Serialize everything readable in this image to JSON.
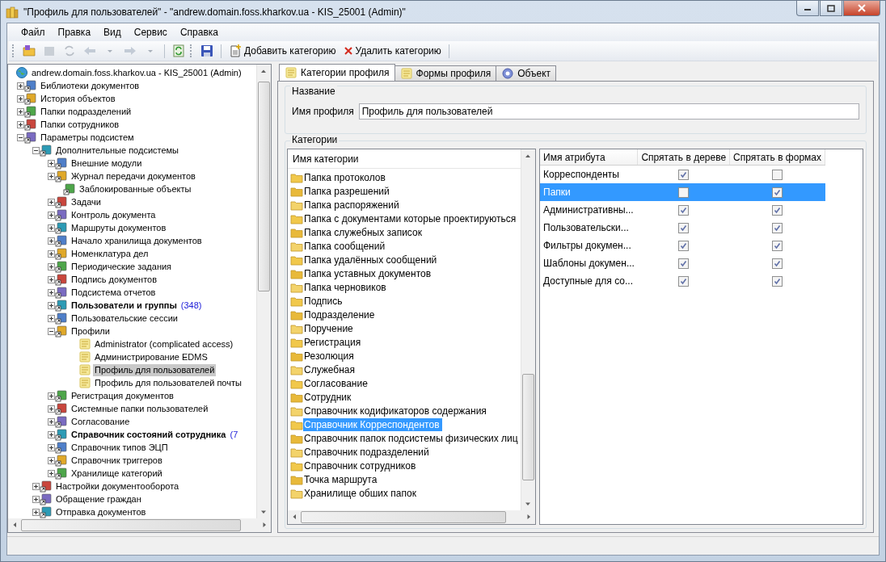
{
  "window": {
    "title": "\"Профиль для пользователей\" - \"andrew.domain.foss.kharkov.ua - KIS_25001 (Admin)\""
  },
  "menu": [
    "Файл",
    "Правка",
    "Вид",
    "Сервис",
    "Справка"
  ],
  "toolbar": {
    "add_button": "Добавить категорию",
    "delete_button": "Удалить категорию"
  },
  "tree": {
    "label": "andrew.domain.foss.kharkov.ua - KIS_25001 (Admin)",
    "selected": false,
    "children": [
      {
        "label": "Библиотеки документов",
        "expanded": false,
        "selected": false
      },
      {
        "label": "История объектов",
        "expanded": false,
        "selected": false
      },
      {
        "label": "Папки подразделений",
        "expanded": false,
        "selected": false
      },
      {
        "label": "Папки сотрудников",
        "expanded": false,
        "selected": false
      },
      {
        "label": "Параметры подсистем",
        "expanded": true,
        "selected": false,
        "children": [
          {
            "label": "Дополнительные подсистемы",
            "expanded": true,
            "selected": false,
            "children": [
              {
                "label": "Внешние модули",
                "expanded": false,
                "selected": false
              },
              {
                "label": "Журнал передачи документов",
                "expanded": false,
                "selected": false
              },
              {
                "label": "Заблокированные объекты",
                "selected": false
              },
              {
                "label": "Задачи",
                "expanded": false,
                "selected": false
              },
              {
                "label": "Контроль документа",
                "expanded": false,
                "selected": false
              },
              {
                "label": "Маршруты документов",
                "expanded": false,
                "selected": false
              },
              {
                "label": "Начало хранилища документов",
                "expanded": false,
                "selected": false
              },
              {
                "label": "Номенклатура дел",
                "expanded": false,
                "selected": false
              },
              {
                "label": "Периодические задания",
                "expanded": false,
                "selected": false
              },
              {
                "label": "Подпись документов",
                "expanded": false,
                "selected": false
              },
              {
                "label": "Подсистема отчетов",
                "expanded": false,
                "selected": false
              },
              {
                "label": "Пользователи и группы",
                "count": "(348)",
                "bold": true,
                "expanded": false,
                "selected": false
              },
              {
                "label": "Пользовательские сессии",
                "expanded": false,
                "selected": false
              },
              {
                "label": "Профили",
                "expanded": true,
                "selected": false,
                "children": [
                  {
                    "label": "Administrator (complicated access)",
                    "selected": false
                  },
                  {
                    "label": "Администрирование EDMS",
                    "selected": false
                  },
                  {
                    "label": "Профиль для пользователей",
                    "selected": true
                  },
                  {
                    "label": "Профиль для пользователей почты",
                    "selected": false
                  }
                ]
              },
              {
                "label": "Регистрация документов",
                "expanded": false,
                "selected": false
              },
              {
                "label": "Системные папки пользователей",
                "expanded": false,
                "selected": false
              },
              {
                "label": "Согласование",
                "expanded": false,
                "selected": false
              },
              {
                "label": "Справочник состояний сотрудника",
                "count": "(7",
                "bold": true,
                "expanded": false,
                "selected": false
              },
              {
                "label": "Справочник типов ЭЦП",
                "expanded": false,
                "selected": false
              },
              {
                "label": "Справочник триггеров",
                "expanded": false,
                "selected": false
              },
              {
                "label": "Хранилище категорий",
                "expanded": false,
                "selected": false
              }
            ]
          },
          {
            "label": "Настройки документооборота",
            "expanded": false,
            "selected": false
          },
          {
            "label": "Обращение граждан",
            "expanded": false,
            "selected": false
          },
          {
            "label": "Отправка документов",
            "expanded": false,
            "selected": false
          }
        ]
      }
    ]
  },
  "tabs": [
    {
      "label": "Категории профиля",
      "selected": true
    },
    {
      "label": "Формы профиля",
      "selected": false
    },
    {
      "label": "Объект",
      "selected": false
    }
  ],
  "name_group": {
    "title": "Название",
    "field_label": "Имя профиля",
    "value": "Профиль для пользователей"
  },
  "categories_group": {
    "title": "Категории",
    "list": {
      "header": "Имя категории",
      "items": [
        {
          "label": "Папка протоколов",
          "selected": false
        },
        {
          "label": "Папка разрешений",
          "selected": false
        },
        {
          "label": "Папка распоряжений",
          "selected": false
        },
        {
          "label": "Папка с документами которые проектируються",
          "selected": false
        },
        {
          "label": "Папка служебных записок",
          "selected": false
        },
        {
          "label": "Папка сообщений",
          "selected": false
        },
        {
          "label": "Папка удалённых сообщений",
          "selected": false
        },
        {
          "label": "Папка уставных документов",
          "selected": false
        },
        {
          "label": "Папка черновиков",
          "selected": false
        },
        {
          "label": "Подпись",
          "selected": false
        },
        {
          "label": "Подразделение",
          "selected": false
        },
        {
          "label": "Поручение",
          "selected": false
        },
        {
          "label": "Регистрация",
          "selected": false
        },
        {
          "label": "Резолюция",
          "selected": false
        },
        {
          "label": "Служебная",
          "selected": false
        },
        {
          "label": "Согласование",
          "selected": false
        },
        {
          "label": "Сотрудник",
          "selected": false
        },
        {
          "label": "Справочник кодификаторов содержания",
          "selected": false
        },
        {
          "label": "Справочник Корреспондентов",
          "selected": true
        },
        {
          "label": "Справочник папок подсистемы физических лиц",
          "selected": false
        },
        {
          "label": "Справочник подразделений",
          "selected": false
        },
        {
          "label": "Справочник сотрудников",
          "selected": false
        },
        {
          "label": "Точка маршрута",
          "selected": false
        },
        {
          "label": "Хранилище обших папок",
          "selected": false
        }
      ]
    },
    "attributes": {
      "columns": [
        "Имя атрибута",
        "Спрятать в дереве",
        "Спрятать в формах"
      ],
      "rows": [
        {
          "name": "Корреспонденты",
          "hide_in_tree": true,
          "hide_in_forms": false,
          "selected": false
        },
        {
          "name": "Папки",
          "hide_in_tree": false,
          "hide_in_forms": true,
          "selected": true
        },
        {
          "name": "Административны...",
          "hide_in_tree": true,
          "hide_in_forms": true,
          "selected": false
        },
        {
          "name": "Пользовательски...",
          "hide_in_tree": true,
          "hide_in_forms": true,
          "selected": false
        },
        {
          "name": "Фильтры докумен...",
          "hide_in_tree": true,
          "hide_in_forms": true,
          "selected": false
        },
        {
          "name": "Шаблоны докумен...",
          "hide_in_tree": true,
          "hide_in_forms": true,
          "selected": false
        },
        {
          "name": "Доступные для со...",
          "hide_in_tree": true,
          "hide_in_forms": true,
          "selected": false
        }
      ]
    }
  }
}
